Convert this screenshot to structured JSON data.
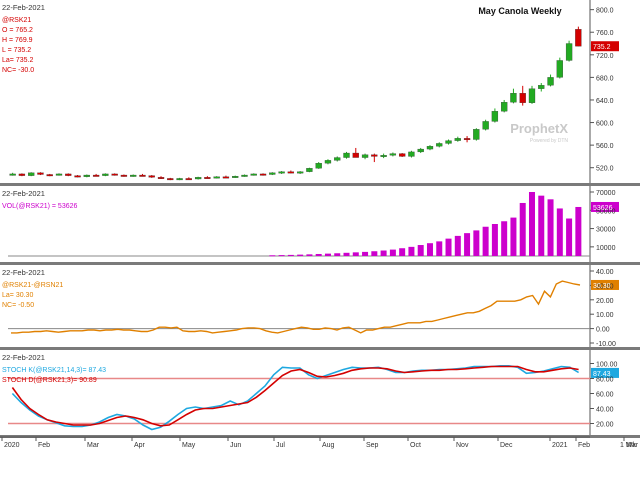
{
  "panels": [
    {
      "id": "price",
      "date": "22-Feb-2021",
      "legend": [
        {
          "text": "@RSK21",
          "color": "#d40000"
        },
        {
          "text": "O = 765.2",
          "color": "#d40000"
        },
        {
          "text": "H = 769.9",
          "color": "#d40000"
        },
        {
          "text": "L = 735.2",
          "color": "#d40000"
        },
        {
          "text": "La= 735.2",
          "color": "#d40000"
        },
        {
          "text": "NC= -30.0",
          "color": "#d40000"
        }
      ],
      "title": "May Canola Weekly",
      "watermark": "ProphetX",
      "watermark_sub": "Powered by DTN",
      "y_ticks": [
        "800.0",
        "760.0",
        "720.0",
        "680.0",
        "640.0",
        "600.0",
        "560.0",
        "520.0"
      ],
      "last_value": "735.2",
      "last_value_color": "#d40000"
    },
    {
      "id": "volume",
      "date": "22-Feb-2021",
      "legend": [
        {
          "text": "VOL(@RSK21) = 53626",
          "color": "#cc00cc"
        }
      ],
      "y_ticks": [
        "70000",
        "50000",
        "30000",
        "10000"
      ],
      "last_value": "53626",
      "last_value_color": "#cc00cc"
    },
    {
      "id": "spread",
      "date": "22-Feb-2021",
      "legend": [
        {
          "text": "@RSK21-@RSN21",
          "color": "#e08000"
        },
        {
          "text": "La= 30.30",
          "color": "#e08000"
        },
        {
          "text": "NC= -0.50",
          "color": "#e08000"
        }
      ],
      "y_ticks": [
        "40.00",
        "30.00",
        "20.00",
        "10.00",
        "0.00",
        "-10.00"
      ],
      "last_value": "30.30",
      "last_value_color": "#e08000"
    },
    {
      "id": "stoch",
      "date": "22-Feb-2021",
      "legend": [
        {
          "text": "STOCH K(@RSK21,14,3)= 87.43",
          "color": "#1ea8e0"
        },
        {
          "text": "STOCH D(@RSK21,3)= 90.89",
          "color": "#d40000"
        }
      ],
      "y_ticks": [
        "100.00",
        "80.00",
        "60.00",
        "40.00",
        "20.00"
      ],
      "last_value": "87.43",
      "last_value_color": "#1ea8e0"
    }
  ],
  "x_axis": {
    "labels": [
      "2020",
      "Feb",
      "Mar",
      "Apr",
      "May",
      "Jun",
      "Jul",
      "Aug",
      "Sep",
      "Oct",
      "Nov",
      "Dec",
      "2021",
      "Feb",
      "Mar"
    ],
    "corner_label": "1 Wk"
  },
  "chart_data": [
    {
      "type": "candlestick",
      "title": "May Canola Weekly",
      "timeframe": "weekly",
      "x_range": [
        "2020-01",
        "2021-03"
      ],
      "ylim": [
        500,
        810
      ],
      "up_color": "#22aa22",
      "down_color": "#d40000",
      "candles_ohlc": [
        [
          508,
          511,
          506,
          509
        ],
        [
          509,
          510,
          505,
          506
        ],
        [
          506,
          512,
          505,
          511
        ],
        [
          511,
          512,
          507,
          508
        ],
        [
          508,
          509,
          505,
          507
        ],
        [
          507,
          510,
          506,
          509
        ],
        [
          509,
          510,
          505,
          506
        ],
        [
          506,
          507,
          503,
          504
        ],
        [
          504,
          508,
          503,
          507
        ],
        [
          507,
          509,
          505,
          506
        ],
        [
          506,
          510,
          505,
          509
        ],
        [
          509,
          510,
          506,
          507
        ],
        [
          507,
          508,
          504,
          505
        ],
        [
          505,
          508,
          504,
          507
        ],
        [
          507,
          509,
          505,
          506
        ],
        [
          506,
          507,
          502,
          503
        ],
        [
          503,
          505,
          500,
          501
        ],
        [
          501,
          502,
          498,
          499
        ],
        [
          499,
          502,
          498,
          501
        ],
        [
          501,
          503,
          499,
          500
        ],
        [
          500,
          504,
          499,
          503
        ],
        [
          503,
          505,
          501,
          502
        ],
        [
          502,
          505,
          501,
          504
        ],
        [
          504,
          506,
          502,
          503
        ],
        [
          503,
          506,
          502,
          505
        ],
        [
          505,
          508,
          504,
          507
        ],
        [
          507,
          510,
          506,
          509
        ],
        [
          509,
          510,
          506,
          508
        ],
        [
          508,
          512,
          507,
          511
        ],
        [
          511,
          514,
          509,
          513
        ],
        [
          513,
          515,
          510,
          511
        ],
        [
          511,
          514,
          509,
          513
        ],
        [
          513,
          520,
          512,
          519
        ],
        [
          519,
          530,
          518,
          528
        ],
        [
          528,
          535,
          526,
          533
        ],
        [
          533,
          540,
          531,
          538
        ],
        [
          538,
          548,
          536,
          546
        ],
        [
          546,
          555,
          544,
          538
        ],
        [
          538,
          545,
          535,
          543
        ],
        [
          543,
          545,
          530,
          540
        ],
        [
          540,
          545,
          537,
          542
        ],
        [
          542,
          547,
          540,
          545
        ],
        [
          545,
          546,
          539,
          540
        ],
        [
          540,
          550,
          538,
          548
        ],
        [
          548,
          555,
          546,
          553
        ],
        [
          553,
          560,
          551,
          558
        ],
        [
          558,
          565,
          556,
          563
        ],
        [
          563,
          570,
          561,
          568
        ],
        [
          568,
          575,
          566,
          572
        ],
        [
          572,
          576,
          565,
          570
        ],
        [
          570,
          590,
          568,
          588
        ],
        [
          588,
          605,
          586,
          602
        ],
        [
          602,
          625,
          600,
          620
        ],
        [
          620,
          640,
          618,
          636
        ],
        [
          636,
          660,
          634,
          652
        ],
        [
          652,
          665,
          630,
          635
        ],
        [
          635,
          665,
          633,
          660
        ],
        [
          660,
          670,
          655,
          666
        ],
        [
          666,
          685,
          664,
          680
        ],
        [
          680,
          715,
          678,
          710
        ],
        [
          710,
          745,
          708,
          740
        ],
        [
          765.2,
          769.9,
          735.2,
          735.2
        ]
      ]
    },
    {
      "type": "bar",
      "name": "VOL(@RSK21)",
      "ylim": [
        0,
        70000
      ],
      "values": [
        0,
        0,
        0,
        0,
        0,
        0,
        0,
        0,
        0,
        0,
        0,
        0,
        0,
        0,
        0,
        0,
        0,
        0,
        0,
        0,
        0,
        0,
        0,
        0,
        0,
        0,
        0,
        0,
        800,
        1000,
        1200,
        1500,
        1800,
        2200,
        2600,
        3000,
        3500,
        4000,
        4500,
        5200,
        6000,
        7000,
        8500,
        10000,
        12000,
        14000,
        16000,
        19000,
        22000,
        25000,
        28000,
        32000,
        35000,
        38000,
        42000,
        58000,
        70000,
        66000,
        62000,
        52000,
        41000,
        53626
      ]
    },
    {
      "type": "line",
      "name": "@RSK21-@RSN21",
      "ylim": [
        -10,
        40
      ],
      "values": [
        -3,
        -3,
        -2.5,
        -2.5,
        -2,
        -2,
        -1.5,
        -2,
        -2.5,
        -2,
        -1.5,
        -1.5,
        -1.5,
        -1,
        -1,
        -1.5,
        -1,
        -1,
        -0.5,
        -1,
        -1,
        -1.5,
        -2,
        -2,
        -1,
        1,
        1,
        0.5,
        1,
        -1.5,
        -2,
        -2,
        -1.5,
        -2,
        -3,
        -2.5,
        -2,
        -1.5,
        -1,
        0,
        0.5,
        0.5,
        0,
        -1.5,
        -2.5,
        -3,
        -2,
        -1,
        0,
        1,
        0.5,
        -0.5,
        -0.5,
        0.5,
        0,
        -1,
        0.5,
        1,
        -1,
        -3,
        -1,
        -1,
        0,
        1,
        1,
        2,
        3,
        4,
        4,
        4,
        5,
        5,
        6,
        7,
        8,
        9,
        10,
        11,
        11,
        12,
        14,
        16,
        19,
        19,
        19,
        19,
        20,
        22,
        23,
        17,
        26,
        22,
        31,
        33,
        32,
        31,
        30.3
      ]
    },
    {
      "type": "line",
      "ylim": [
        10,
        110
      ],
      "series": [
        {
          "name": "STOCH K(@RSK21,14,3)",
          "values": [
            60,
            48,
            38,
            30,
            25,
            21,
            17,
            16,
            16,
            18,
            22,
            28,
            32,
            30,
            26,
            18,
            12,
            15,
            23,
            32,
            40,
            42,
            40,
            42,
            44,
            50,
            45,
            50,
            60,
            70,
            85,
            95,
            94,
            94,
            85,
            80,
            84,
            88,
            92,
            95,
            94,
            94,
            95,
            92,
            88,
            88,
            90,
            91,
            91,
            92,
            92,
            93,
            94,
            96,
            96,
            96,
            97,
            97,
            95,
            87,
            88,
            90,
            93,
            96,
            95,
            88
          ]
        },
        {
          "name": "STOCH D(@RSK21,3)",
          "values": [
            68,
            52,
            40,
            32,
            25,
            22,
            20,
            18,
            18,
            18,
            20,
            24,
            28,
            30,
            28,
            25,
            20,
            17,
            18,
            25,
            32,
            38,
            40,
            40,
            42,
            44,
            46,
            48,
            55,
            64,
            74,
            84,
            90,
            92,
            88,
            83,
            82,
            84,
            87,
            91,
            93,
            94,
            94,
            93,
            90,
            88,
            89,
            90,
            91,
            91,
            92,
            92,
            93,
            94,
            95,
            96,
            96,
            96,
            96,
            92,
            89,
            89,
            91,
            93,
            94,
            92
          ]
        }
      ],
      "reference_lines": [
        80,
        20
      ]
    }
  ]
}
